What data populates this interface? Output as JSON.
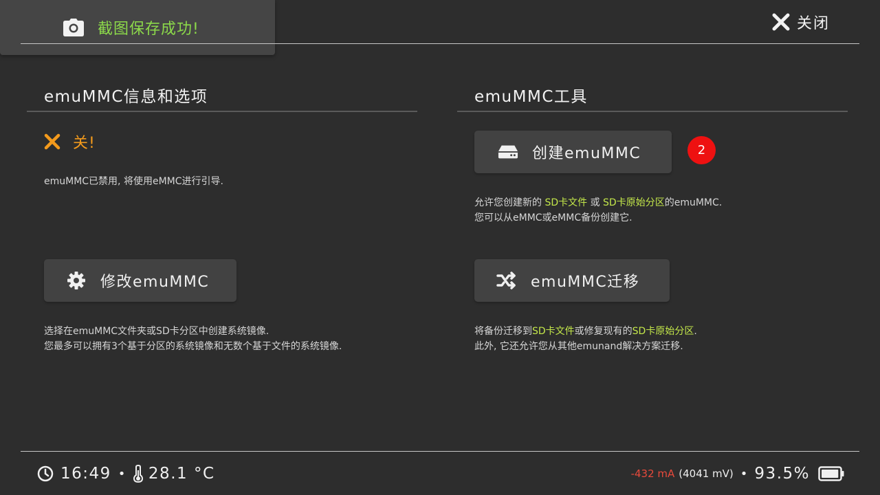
{
  "toast": {
    "message": "截图保存成功!",
    "icon": "camera-icon"
  },
  "header": {
    "close_label": "关闭"
  },
  "left": {
    "title": "emuMMC信息和选项",
    "status": "关!",
    "status_desc": "emuMMC已禁用, 将使用eMMC进行引导.",
    "modify_button": "修改emuMMC",
    "modify_desc_line1": "选择在emuMMC文件夹或SD卡分区中创建系统镜像.",
    "modify_desc_line2": "您最多可以拥有3个基于分区的系统镜像和无数个基于文件的系统镜像."
  },
  "right": {
    "title": "emuMMC工具",
    "create_button": "创建emuMMC",
    "badge": "2",
    "create_desc": {
      "p1": "允许您创建新的 ",
      "h1": "SD卡文件",
      "p2": " 或 ",
      "h2": "SD卡原始分区",
      "p3": "的emuMMC.",
      "line2": "您可以从eMMC或eMMC备份创建它."
    },
    "migrate_button": "emuMMC迁移",
    "migrate_desc": {
      "p1": "将备份迁移到",
      "h1": "SD卡文件",
      "p2": "或修复现有的",
      "h2": "SD卡原始分区",
      "p3": ".",
      "line2": "此外, 它还允许您从其他emunand解决方案迁移."
    }
  },
  "footer": {
    "time": "16:49",
    "temperature": "28.1 °C",
    "current": "-432 mA",
    "voltage": "(4041 mV)",
    "battery_percent": "93.5%",
    "battery_level": 0.935
  },
  "colors": {
    "accent_green": "#8cd94a",
    "highlight": "#c4e84a",
    "warning_orange": "#f39a1c",
    "badge_red": "#ee1111",
    "current_red": "#e84a3c"
  }
}
